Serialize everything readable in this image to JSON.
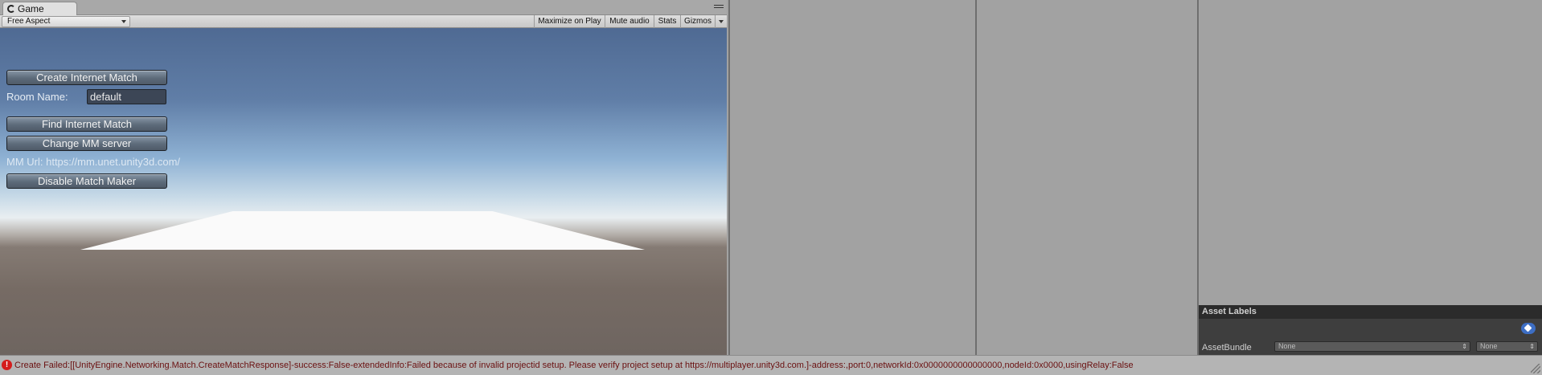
{
  "game_window": {
    "tab_label": "Game",
    "tab_icon": "pacman-icon",
    "aspect_dropdown": "Free Aspect",
    "toolbar": {
      "maximize": "Maximize on Play",
      "mute": "Mute audio",
      "stats": "Stats",
      "gizmos": "Gizmos"
    }
  },
  "game_ui": {
    "create_button": "Create Internet Match",
    "room_label": "Room Name:",
    "room_value": "default",
    "find_button": "Find Internet Match",
    "change_mm_button": "Change MM server",
    "mm_url": "MM Url: https://mm.unet.unity3d.com/",
    "disable_button": "Disable Match Maker"
  },
  "asset_labels": {
    "header": "Asset Labels",
    "assetbundle_label": "AssetBundle",
    "assetbundle_value": "None",
    "variant_value": "None"
  },
  "status": {
    "icon": "error-icon",
    "message": "Create Failed:[[UnityEngine.Networking.Match.CreateMatchResponse]-success:False-extendedInfo:Failed because of invalid projectid setup. Please verify project setup at https://multiplayer.unity3d.com.]-address:,port:0,networkId:0x0000000000000000,nodeId:0x0000,usingRelay:False"
  }
}
